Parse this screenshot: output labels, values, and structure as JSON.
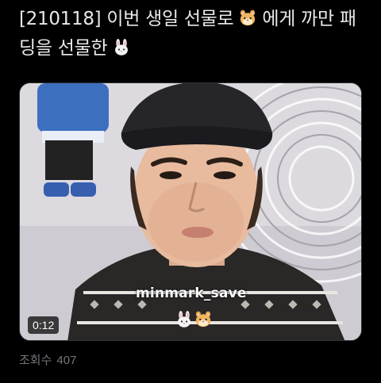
{
  "tweet": {
    "text_part1": "[210118] 이번 생일 선물로 ",
    "emoji1": "hamster-face",
    "text_part2": " 에게 까만 패딩을 선물한 ",
    "emoji2": "rabbit-face"
  },
  "media": {
    "watermark_text": "minmark_save",
    "watermark_emojis": [
      "rabbit-face",
      "hamster-face"
    ],
    "duration": "0:12"
  },
  "stats": {
    "views_label": "조회수",
    "views_count": "407"
  }
}
